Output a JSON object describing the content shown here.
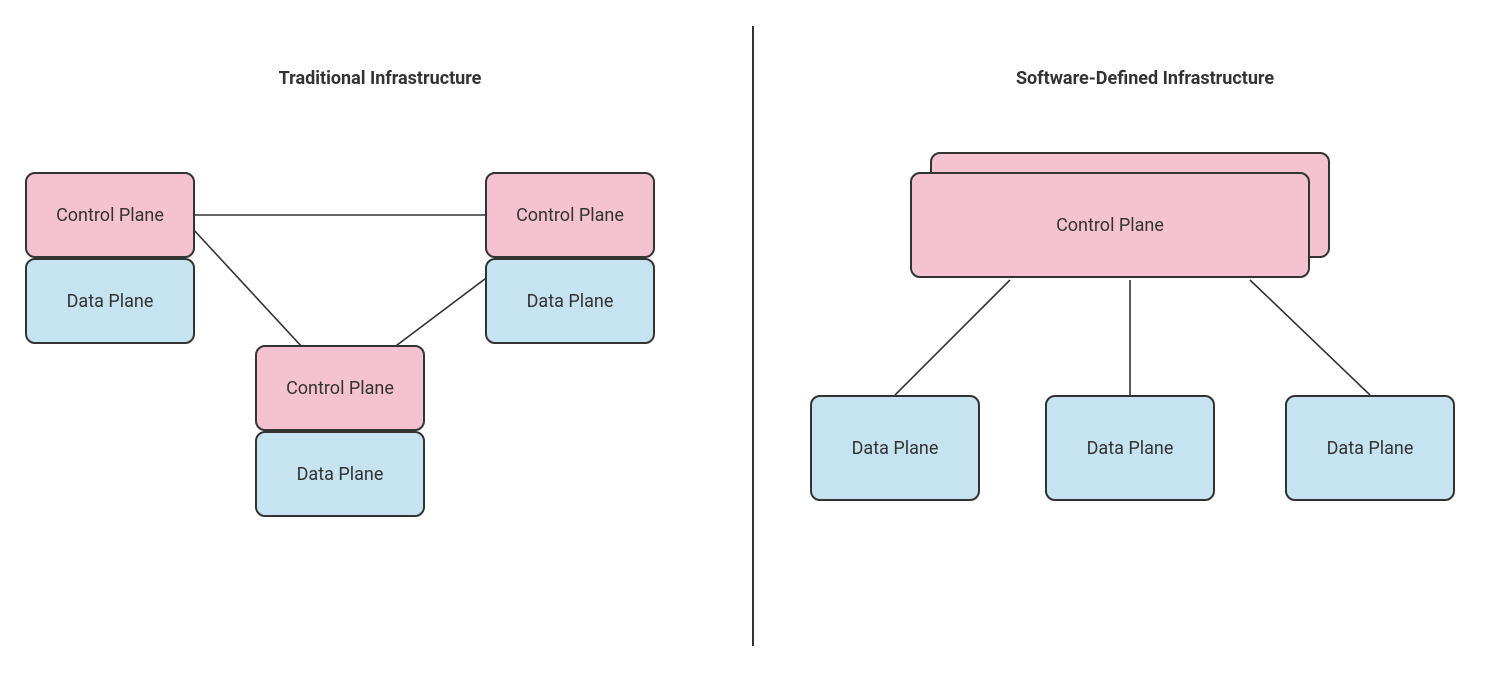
{
  "left": {
    "title": "Traditional Infrastructure",
    "nodes": {
      "cp1": "Control Plane",
      "dp1": "Data Plane",
      "cp2": "Control Plane",
      "dp2": "Data Plane",
      "cp3": "Control Plane",
      "dp3": "Data Plane"
    }
  },
  "right": {
    "title": "Software-Defined Infrastructure",
    "nodes": {
      "cp": "Control Plane",
      "dp1": "Data Plane",
      "dp2": "Data Plane",
      "dp3": "Data Plane"
    }
  },
  "colors": {
    "control_plane": "#f4c2d0",
    "data_plane": "#c5e3f0",
    "stroke": "#333333"
  }
}
